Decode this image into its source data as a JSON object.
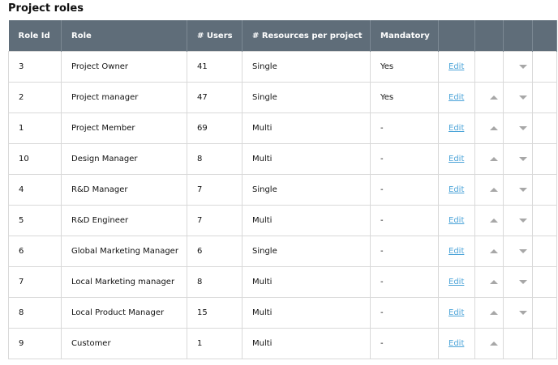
{
  "title": "Project roles",
  "headers": {
    "role_id": "Role Id",
    "role": "Role",
    "users": "# Users",
    "resources": "# Resources per project",
    "mandatory": "Mandatory"
  },
  "edit_label": "Edit",
  "rows": [
    {
      "id": "3",
      "role": "Project Owner",
      "users": "41",
      "resources": "Single",
      "mandatory": "Yes",
      "up": false,
      "down": true
    },
    {
      "id": "2",
      "role": "Project manager",
      "users": "47",
      "resources": "Single",
      "mandatory": "Yes",
      "up": true,
      "down": true
    },
    {
      "id": "1",
      "role": "Project Member",
      "users": "69",
      "resources": "Multi",
      "mandatory": "-",
      "up": true,
      "down": true
    },
    {
      "id": "10",
      "role": "Design Manager",
      "users": "8",
      "resources": "Multi",
      "mandatory": "-",
      "up": true,
      "down": true
    },
    {
      "id": "4",
      "role": "R&D Manager",
      "users": "7",
      "resources": "Single",
      "mandatory": "-",
      "up": true,
      "down": true
    },
    {
      "id": "5",
      "role": "R&D Engineer",
      "users": "7",
      "resources": "Multi",
      "mandatory": "-",
      "up": true,
      "down": true
    },
    {
      "id": "6",
      "role": "Global Marketing Manager",
      "users": "6",
      "resources": "Single",
      "mandatory": "-",
      "up": true,
      "down": true
    },
    {
      "id": "7",
      "role": "Local Marketing manager",
      "users": "8",
      "resources": "Multi",
      "mandatory": "-",
      "up": true,
      "down": true
    },
    {
      "id": "8",
      "role": "Local Product Manager",
      "users": "15",
      "resources": "Multi",
      "mandatory": "-",
      "up": true,
      "down": true
    },
    {
      "id": "9",
      "role": "Customer",
      "users": "1",
      "resources": "Multi",
      "mandatory": "-",
      "up": true,
      "down": false
    }
  ]
}
